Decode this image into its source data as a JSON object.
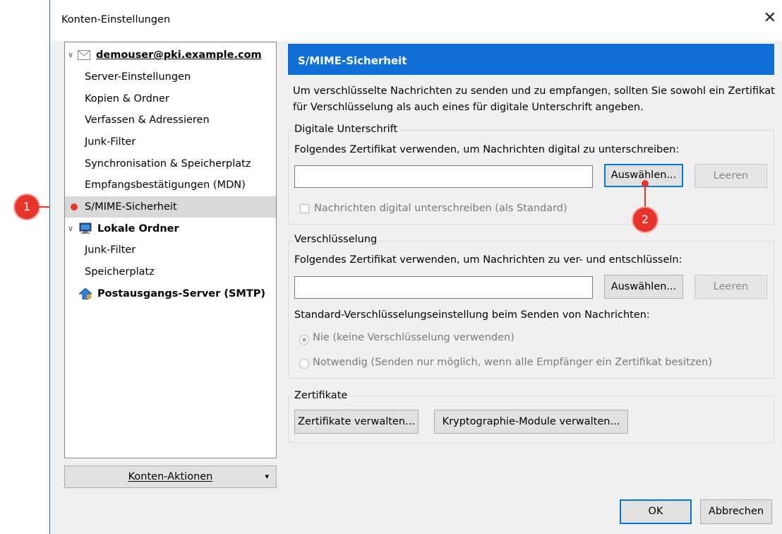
{
  "window": {
    "title": "Konten-Einstellungen",
    "close_glyph": "✕"
  },
  "tree": {
    "account1": "demouser@pki.example.com",
    "items1": [
      "Server-Einstellungen",
      "Kopien & Ordner",
      "Verfassen & Adressieren",
      "Junk-Filter",
      "Synchronisation & Speicherplatz",
      "Empfangsbestätigungen (MDN)",
      "S/MIME-Sicherheit"
    ],
    "account2": "Lokale Ordner",
    "items2": [
      "Junk-Filter",
      "Speicherplatz"
    ],
    "account3": "Postausgangs-Server (SMTP)",
    "selected": "S/MIME-Sicherheit"
  },
  "account_actions": {
    "label": "Konten-Aktionen",
    "arrow": "▾"
  },
  "panel": {
    "title": "S/MIME-Sicherheit",
    "intro": "Um verschlüsselte Nachrichten zu senden und zu empfangen, sollten Sie sowohl ein Zertifikat für Verschlüsselung als auch eines für digitale Unterschrift angeben.",
    "signing": {
      "group_title": "Digitale Unterschrift",
      "desc": "Folgendes Zertifikat verwenden, um Nachrichten digital zu unterschreiben:",
      "value": "",
      "select_label": "Auswählen...",
      "clear_label": "Leeren",
      "checkbox_label": "Nachrichten digital unterschreiben (als Standard)",
      "checked": false
    },
    "encryption": {
      "group_title": "Verschlüsselung",
      "desc": "Folgendes Zertifikat verwenden, um Nachrichten zu ver- und entschlüsseln:",
      "value": "",
      "select_label": "Auswählen...",
      "clear_label": "Leeren",
      "default_label": "Standard-Verschlüsselungseinstellung beim Senden von Nachrichten:",
      "option_never": "Nie (keine Verschlüsselung verwenden)",
      "option_required": "Notwendig (Senden nur möglich, wenn alle Empfänger ein Zertifikat besitzen)",
      "selected_option": "Nie (keine Verschlüsselung verwenden)"
    },
    "certificates": {
      "group_title": "Zertifikate",
      "manage_label": "Zertifikate verwalten...",
      "modules_label": "Kryptographie-Module verwalten..."
    }
  },
  "footer": {
    "ok": "OK",
    "cancel": "Abbrechen"
  },
  "callouts": {
    "one": "1",
    "two": "2",
    "color": "#e8352b"
  },
  "colors": {
    "accent": "#0f6fd7",
    "window_border": "#1979ca",
    "selection": "#d9d9d9"
  }
}
